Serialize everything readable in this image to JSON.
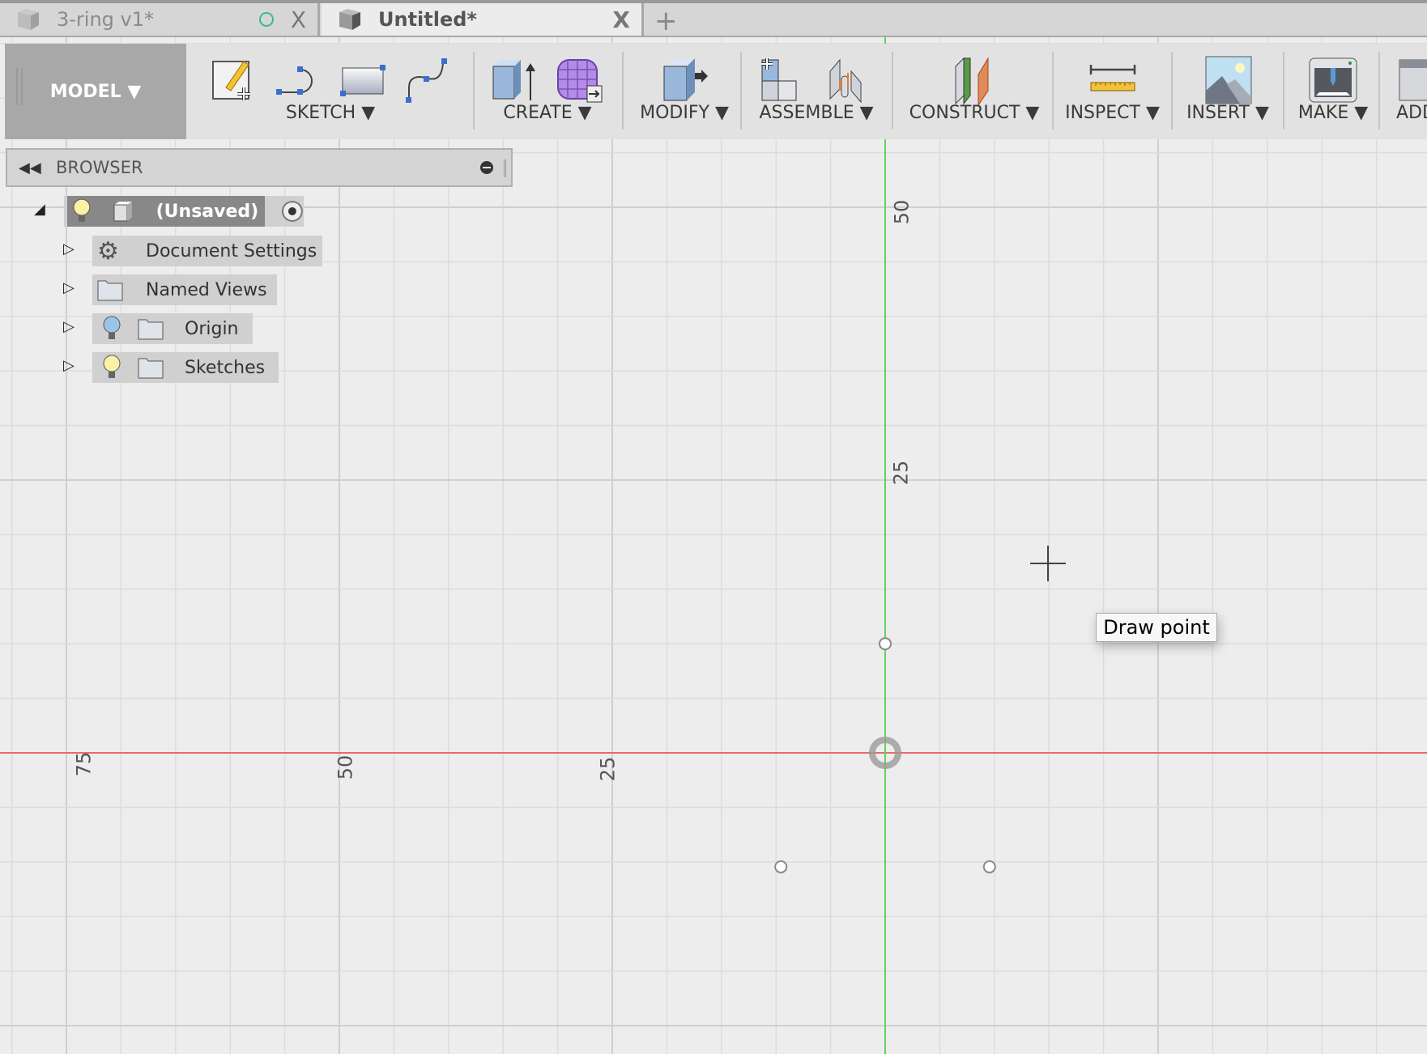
{
  "tabs": [
    {
      "label": "3-ring v1*",
      "active": false,
      "icon": "cube-icon",
      "status": "saved-status-icon"
    },
    {
      "label": "Untitled*",
      "active": true,
      "icon": "cube-icon"
    }
  ],
  "new_tab_label": "+",
  "close_label": "X",
  "toolbar": {
    "workspace": "MODEL ▼",
    "groups": [
      {
        "label": "SKETCH ▼",
        "icons": [
          "create-sketch-icon",
          "arc-icon",
          "rectangle-icon",
          "spline-icon"
        ]
      },
      {
        "label": "CREATE ▼",
        "icons": [
          "extrude-icon",
          "form-icon"
        ]
      },
      {
        "label": "MODIFY ▼",
        "icons": [
          "press-pull-icon"
        ]
      },
      {
        "label": "ASSEMBLE ▼",
        "icons": [
          "new-component-icon",
          "joint-icon"
        ]
      },
      {
        "label": "CONSTRUCT ▼",
        "icons": [
          "offset-plane-icon"
        ]
      },
      {
        "label": "INSPECT ▼",
        "icons": [
          "measure-icon"
        ]
      },
      {
        "label": "INSERT ▼",
        "icons": [
          "insert-image-icon"
        ]
      },
      {
        "label": "MAKE ▼",
        "icons": [
          "3d-print-icon"
        ]
      },
      {
        "label": "ADD",
        "icons": [
          "add-ins-icon"
        ]
      }
    ]
  },
  "browser": {
    "title": "BROWSER",
    "root": {
      "label": "(Unsaved)"
    },
    "items": [
      {
        "label": "Document Settings",
        "icon": "gear-icon"
      },
      {
        "label": "Named Views",
        "icon": "folder-icon"
      },
      {
        "label": "Origin",
        "icon": "folder-icon",
        "bulb": "blue"
      },
      {
        "label": "Sketches",
        "icon": "folder-icon",
        "bulb": "yellow"
      }
    ]
  },
  "viewport": {
    "vertical_axis_labels": [
      "50",
      "25"
    ],
    "horizontal_axis_labels": [
      "75",
      "50",
      "25"
    ],
    "axis_colors": {
      "x": "#e86a6a",
      "y": "#5fd35f"
    },
    "tooltip": "Draw point"
  }
}
